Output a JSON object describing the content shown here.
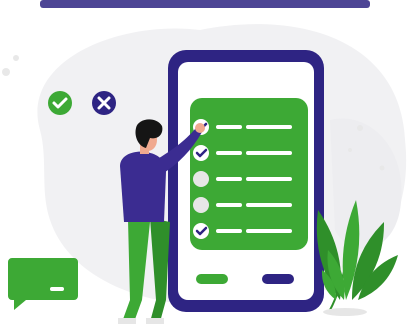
{
  "colors": {
    "green": "#3da935",
    "dark_green": "#2f8f2a",
    "navy": "#2e2483",
    "purple": "#3b2c91",
    "skin": "#f0a98f",
    "hair": "#151515",
    "blob": "#f1f1f3",
    "light_dot": "#e8e8e8"
  },
  "checklist": [
    {
      "checked": true
    },
    {
      "checked": true
    },
    {
      "checked": false
    },
    {
      "checked": false
    },
    {
      "checked": true
    }
  ],
  "icons": {
    "approve": "check-circle-icon",
    "reject": "close-circle-icon",
    "message": "chat-bubble-icon"
  }
}
